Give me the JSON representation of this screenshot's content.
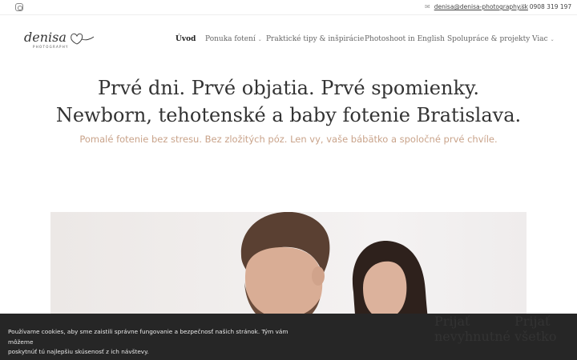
{
  "topbar": {
    "email_icon": "mail-icon",
    "email": "denisa@denisa-photography.sk",
    "phone_icon": "phone-icon",
    "phone": "0908 319 197",
    "social_icon": "instagram-icon"
  },
  "logo": {
    "script": "denisa",
    "sub": "PHOTOGRAPHY"
  },
  "nav": {
    "items": [
      {
        "label": "Úvod",
        "active": true,
        "dropdown": false
      },
      {
        "label": "Ponuka fotení",
        "active": false,
        "dropdown": true
      },
      {
        "label": "Praktické tipy & inšpirácie",
        "active": false,
        "dropdown": false
      },
      {
        "label": "Photoshoot in English",
        "active": false,
        "dropdown": false
      },
      {
        "label": "Spolupráce & projekty",
        "active": false,
        "dropdown": false
      },
      {
        "label": "Viac",
        "active": false,
        "dropdown": true
      }
    ],
    "chevron": "⌄"
  },
  "hero": {
    "line1": "Prvé dni. Prvé objatia. Prvé spomienky.",
    "line2": "Newborn, tehotenské a baby fotenie Bratislava.",
    "tagline": "Pomalé fotenie bez stresu. Bez zložitých póz. Len vy, vaše bábätko a spoločné prvé chvíle."
  },
  "cookie": {
    "line1": "Používame cookies, aby sme zaistili správne fungovanie a bezpečnosť našich stránok. Tým vám môžeme",
    "line2": "poskytnúť tú najlepšiu skúsenosť z ich návštevy.",
    "close": "×",
    "accept_necessary": "Prijať nevyhnutné",
    "accept_all": "Prijať všetko"
  },
  "colors": {
    "accent": "#c9a38a",
    "cookie_bg": "#262626"
  }
}
